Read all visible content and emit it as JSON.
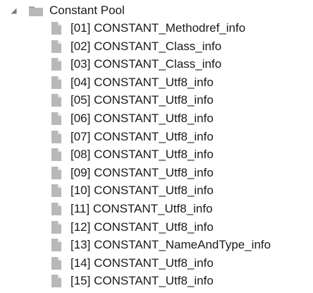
{
  "tree": {
    "root": {
      "label": "Constant Pool",
      "icon": "folder-icon",
      "expanded": true
    },
    "items": [
      {
        "label": "[01] CONSTANT_Methodref_info",
        "icon": "file-icon"
      },
      {
        "label": "[02] CONSTANT_Class_info",
        "icon": "file-icon"
      },
      {
        "label": "[03] CONSTANT_Class_info",
        "icon": "file-icon"
      },
      {
        "label": "[04] CONSTANT_Utf8_info",
        "icon": "file-icon"
      },
      {
        "label": "[05] CONSTANT_Utf8_info",
        "icon": "file-icon"
      },
      {
        "label": "[06] CONSTANT_Utf8_info",
        "icon": "file-icon"
      },
      {
        "label": "[07] CONSTANT_Utf8_info",
        "icon": "file-icon"
      },
      {
        "label": "[08] CONSTANT_Utf8_info",
        "icon": "file-icon"
      },
      {
        "label": "[09] CONSTANT_Utf8_info",
        "icon": "file-icon"
      },
      {
        "label": "[10] CONSTANT_Utf8_info",
        "icon": "file-icon"
      },
      {
        "label": "[11] CONSTANT_Utf8_info",
        "icon": "file-icon"
      },
      {
        "label": "[12] CONSTANT_Utf8_info",
        "icon": "file-icon"
      },
      {
        "label": "[13] CONSTANT_NameAndType_info",
        "icon": "file-icon"
      },
      {
        "label": "[14] CONSTANT_Utf8_info",
        "icon": "file-icon"
      },
      {
        "label": "[15] CONSTANT_Utf8_info",
        "icon": "file-icon"
      }
    ]
  },
  "colors": {
    "icon_gray": "#b3b3b3",
    "arrow_gray": "#7a7a7a",
    "text": "#1a1a1a"
  }
}
